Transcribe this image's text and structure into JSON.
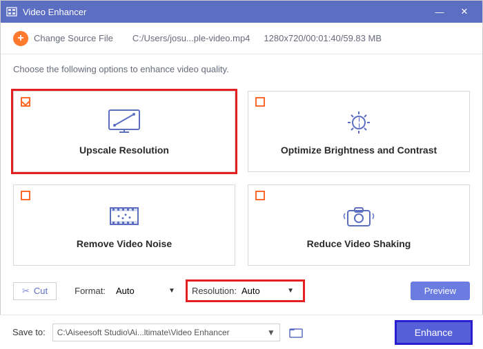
{
  "titlebar": {
    "title": "Video Enhancer"
  },
  "toolbar": {
    "change_label": "Change Source File",
    "filepath": "C:/Users/josu...ple-video.mp4",
    "fileinfo": "1280x720/00:01:40/59.83 MB"
  },
  "instruction": "Choose the following options to enhance video quality.",
  "cards": {
    "upscale": {
      "label": "Upscale Resolution",
      "checked": true
    },
    "brightness": {
      "label": "Optimize Brightness and Contrast",
      "checked": false
    },
    "noise": {
      "label": "Remove Video Noise",
      "checked": false
    },
    "shaking": {
      "label": "Reduce Video Shaking",
      "checked": false
    }
  },
  "controls": {
    "cut": "Cut",
    "format_label": "Format:",
    "format_value": "Auto",
    "resolution_label": "Resolution:",
    "resolution_value": "Auto",
    "preview": "Preview"
  },
  "footer": {
    "save_label": "Save to:",
    "save_path": "C:\\Aiseesoft Studio\\Ai...ltimate\\Video Enhancer",
    "enhance": "Enhance"
  }
}
